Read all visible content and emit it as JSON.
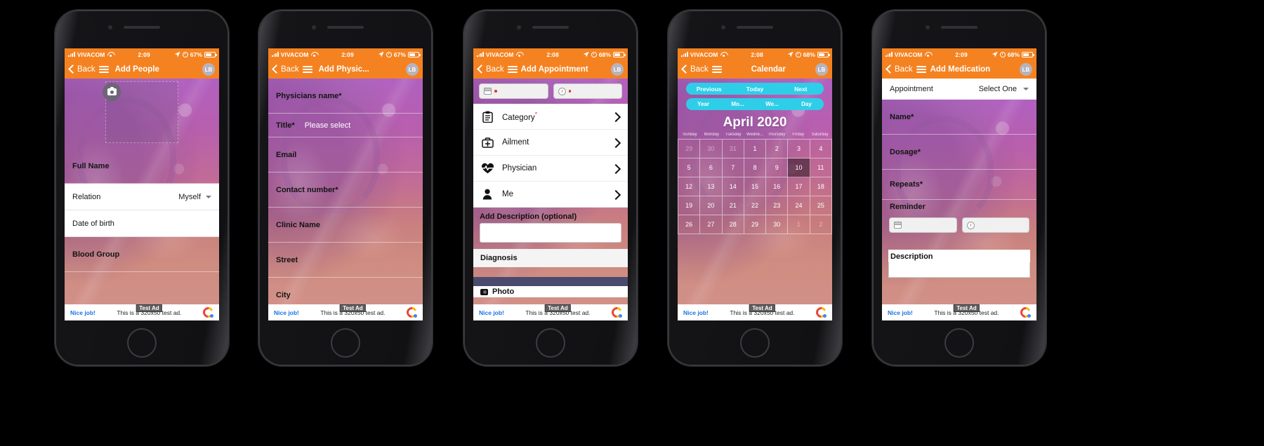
{
  "phones": [
    {
      "id": "add-people",
      "status": {
        "carrier": "VIVACOM",
        "time": "2:09",
        "battery": "67%"
      },
      "nav": {
        "back": "Back",
        "title": "Add People",
        "avatar": "LB"
      },
      "fields": [
        {
          "type": "photo"
        },
        {
          "type": "tinted",
          "label": "Full Name"
        },
        {
          "type": "white",
          "label": "Relation",
          "value": "Myself",
          "caret": true
        },
        {
          "type": "white",
          "label": "Date of birth",
          "value": ""
        },
        {
          "type": "tinted",
          "label": "Blood Group"
        },
        {
          "type": "tinted",
          "label": ""
        }
      ]
    },
    {
      "id": "add-physician",
      "status": {
        "carrier": "VIVACOM",
        "time": "2:09",
        "battery": "67%"
      },
      "nav": {
        "back": "Back",
        "title": "Add Physic...",
        "avatar": "LB"
      },
      "fields": [
        {
          "type": "tinted",
          "label": "Physicians name*"
        },
        {
          "type": "tinted-inline",
          "label": "Title*",
          "value": "Please select"
        },
        {
          "type": "tinted",
          "label": "Email"
        },
        {
          "type": "tinted",
          "label": "Contact number*"
        },
        {
          "type": "tinted",
          "label": "Clinic Name"
        },
        {
          "type": "tinted",
          "label": "Street"
        },
        {
          "type": "tinted",
          "label": "City"
        }
      ]
    },
    {
      "id": "add-appointment",
      "status": {
        "carrier": "VIVACOM",
        "time": "2:08",
        "battery": "68%"
      },
      "nav": {
        "back": "Back",
        "title": "Add Appointment",
        "avatar": "LB"
      },
      "pickers": [
        {
          "icon": "calendar-icon",
          "value": ""
        },
        {
          "icon": "clock-icon",
          "value": ""
        }
      ],
      "list": [
        {
          "icon": "clipboard-icon",
          "label": "Category",
          "required": true
        },
        {
          "icon": "first-aid-kit-icon",
          "label": "Ailment",
          "required": false
        },
        {
          "icon": "heart-pulse-icon",
          "label": "Physician",
          "required": false
        },
        {
          "icon": "person-icon",
          "label": "Me",
          "required": false
        }
      ],
      "description_label": "Add Description (optional)",
      "diagnosis_label": "Diagnosis",
      "photo_label": "Photo"
    },
    {
      "id": "calendar",
      "status": {
        "carrier": "VIVACOM",
        "time": "2:08",
        "battery": "68%"
      },
      "nav": {
        "back": "Back",
        "title": "Calendar",
        "avatar": "LB"
      },
      "nav_buttons": [
        "Previous",
        "Today",
        "Next"
      ],
      "view_buttons": [
        "Year",
        "Mo...",
        "We...",
        "Day"
      ],
      "month_title": "April 2020",
      "weekdays": [
        "Sunday",
        "Monday",
        "Tuesday",
        "Wedne...",
        "Thursday",
        "Friday",
        "Saturday"
      ],
      "grid": [
        [
          {
            "d": "29",
            "dim": true
          },
          {
            "d": "30",
            "dim": true
          },
          {
            "d": "31",
            "dim": true
          },
          {
            "d": "1"
          },
          {
            "d": "2"
          },
          {
            "d": "3"
          },
          {
            "d": "4"
          }
        ],
        [
          {
            "d": "5"
          },
          {
            "d": "6"
          },
          {
            "d": "7"
          },
          {
            "d": "8"
          },
          {
            "d": "9"
          },
          {
            "d": "10",
            "sel": true
          },
          {
            "d": "11"
          }
        ],
        [
          {
            "d": "12"
          },
          {
            "d": "13"
          },
          {
            "d": "14"
          },
          {
            "d": "15"
          },
          {
            "d": "16"
          },
          {
            "d": "17"
          },
          {
            "d": "18"
          }
        ],
        [
          {
            "d": "19"
          },
          {
            "d": "20"
          },
          {
            "d": "21"
          },
          {
            "d": "22"
          },
          {
            "d": "23"
          },
          {
            "d": "24"
          },
          {
            "d": "25"
          }
        ],
        [
          {
            "d": "26"
          },
          {
            "d": "27"
          },
          {
            "d": "28"
          },
          {
            "d": "29"
          },
          {
            "d": "30"
          },
          {
            "d": "1",
            "dim": true
          },
          {
            "d": "2",
            "dim": true
          }
        ]
      ]
    },
    {
      "id": "add-medication",
      "status": {
        "carrier": "VIVACOM",
        "time": "2:09",
        "battery": "68%"
      },
      "nav": {
        "back": "Back",
        "title": "Add Medication",
        "avatar": "LB"
      },
      "appointment": {
        "label": "Appointment",
        "value": "Select One"
      },
      "fields": [
        {
          "type": "tinted",
          "label": "Name*"
        },
        {
          "type": "tinted",
          "label": "Dosage*"
        },
        {
          "type": "tinted",
          "label": "Repeats*"
        }
      ],
      "reminder_label": "Reminder",
      "reminder_pickers": [
        {
          "icon": "calendar-icon"
        },
        {
          "icon": "clock-icon"
        }
      ],
      "description_label": "Description"
    }
  ],
  "ad": {
    "cta": "Nice job!",
    "text": "This is a 320x50 test ad.",
    "tag": "Test Ad"
  },
  "colors": {
    "orange": "#F58220",
    "cyan": "#2ECEE8",
    "link_blue": "#1a73e8",
    "required_red": "#e03a2f"
  }
}
